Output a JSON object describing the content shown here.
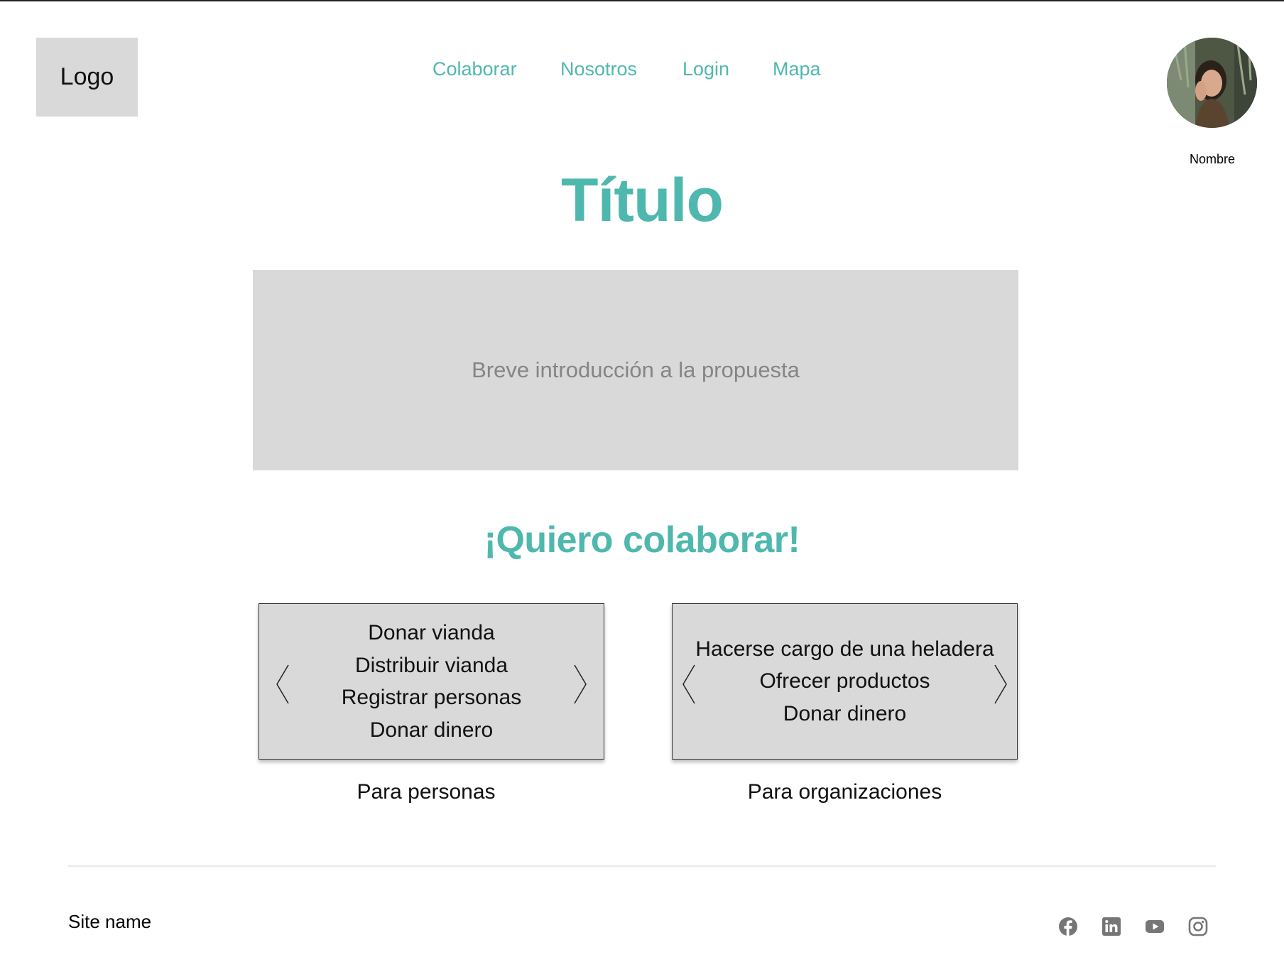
{
  "header": {
    "logo_text": "Logo",
    "nav": [
      {
        "label": "Colaborar"
      },
      {
        "label": "Nosotros"
      },
      {
        "label": "Login"
      },
      {
        "label": "Mapa"
      }
    ],
    "user_name": "Nombre"
  },
  "main": {
    "title": "Título",
    "intro_text": "Breve introducción a la propuesta",
    "collab_title": "¡Quiero colaborar!",
    "persons_card": {
      "items": [
        "Donar vianda",
        "Distribuir vianda",
        "Registrar personas",
        "Donar dinero"
      ],
      "label": "Para personas"
    },
    "orgs_card": {
      "items": [
        "Hacerse cargo de una heladera",
        "Ofrecer productos",
        "Donar dinero"
      ],
      "label": "Para organizaciones"
    }
  },
  "footer": {
    "site_name": "Site name",
    "social_icons": [
      "facebook-icon",
      "linkedin-icon",
      "youtube-icon",
      "instagram-icon"
    ]
  },
  "colors": {
    "accent": "#4fb8ae",
    "placeholder_bg": "#d9d9d9",
    "icon_gray": "#767676"
  }
}
